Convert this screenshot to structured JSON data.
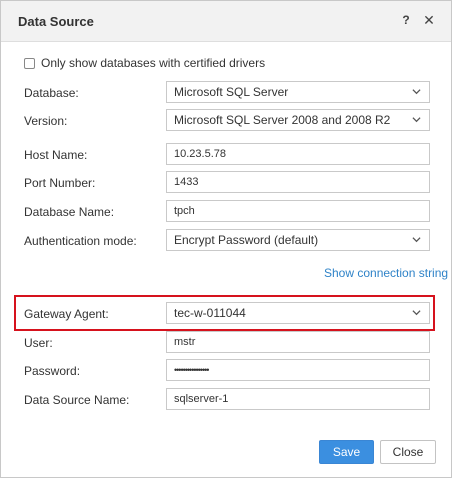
{
  "dialog": {
    "title": "Data Source",
    "help_glyph": "?",
    "close_glyph": "✕"
  },
  "certified_only": {
    "label": "Only show databases with certified drivers",
    "checked": false
  },
  "fields": {
    "database": {
      "label": "Database:",
      "value": "Microsoft SQL Server"
    },
    "version": {
      "label": "Version:",
      "value": "Microsoft SQL Server 2008 and 2008 R2"
    },
    "host_name": {
      "label": "Host Name:",
      "value": "10.23.5.78"
    },
    "port_number": {
      "label": "Port Number:",
      "value": "1433"
    },
    "database_name": {
      "label": "Database Name:",
      "value": "tpch"
    },
    "auth_mode": {
      "label": "Authentication mode:",
      "value": "Encrypt Password (default)"
    },
    "gateway_agent": {
      "label": "Gateway Agent:",
      "value": "tec-w-011044"
    },
    "user": {
      "label": "User:",
      "value": "mstr"
    },
    "password": {
      "label": "Password:",
      "value": "••••••••••••••••"
    },
    "data_source_name": {
      "label": "Data Source Name:",
      "value": "sqlserver-1"
    }
  },
  "show_connection_string": "Show connection string",
  "buttons": {
    "save": "Save",
    "close": "Close"
  },
  "colors": {
    "accent": "#3b8fe0",
    "link": "#2f83c8",
    "highlight": "#d6121d"
  }
}
